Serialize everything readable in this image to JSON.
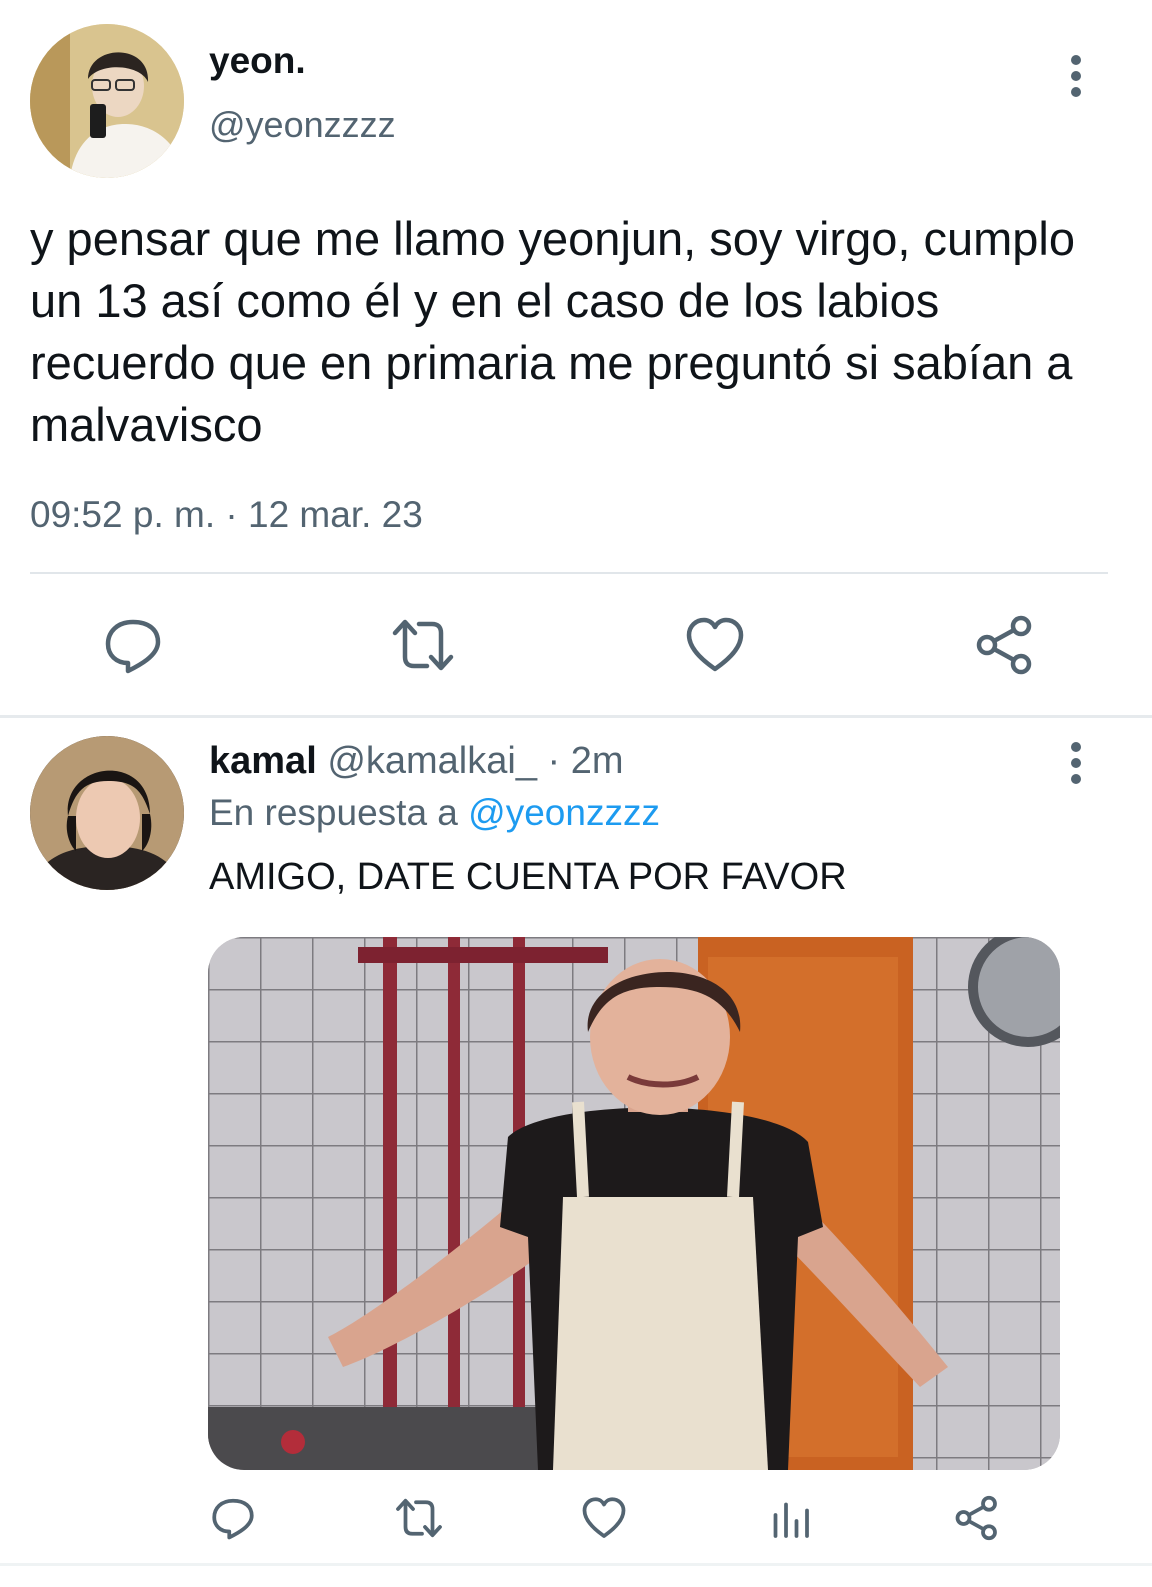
{
  "main_tweet": {
    "display_name": "yeon.",
    "handle": "@yeonzzzz",
    "text": "y pensar que me llamo yeonjun, soy virgo, cumplo un 13 así como él y en el caso de los labios recuerdo que en primaria me preguntó si sabían a malvavisco",
    "timestamp": "09:52 p. m. · 12 mar. 23",
    "actions": [
      "reply-icon",
      "retweet-icon",
      "like-icon",
      "share-icon"
    ]
  },
  "reply_tweet": {
    "display_name": "kamal",
    "handle": "@kamalkai_",
    "time": " · 2m",
    "in_reply_prefix": "En respuesta a ",
    "in_reply_mention": "@yeonzzzz",
    "text": "AMIGO, DATE CUENTA POR FAVOR",
    "actions": [
      "reply-icon",
      "retweet-icon",
      "like-icon",
      "analytics-icon",
      "share-icon"
    ]
  },
  "colors": {
    "text_primary": "#0f1419",
    "text_secondary": "#536471",
    "link": "#1d9bf0",
    "icon": "#536471"
  }
}
